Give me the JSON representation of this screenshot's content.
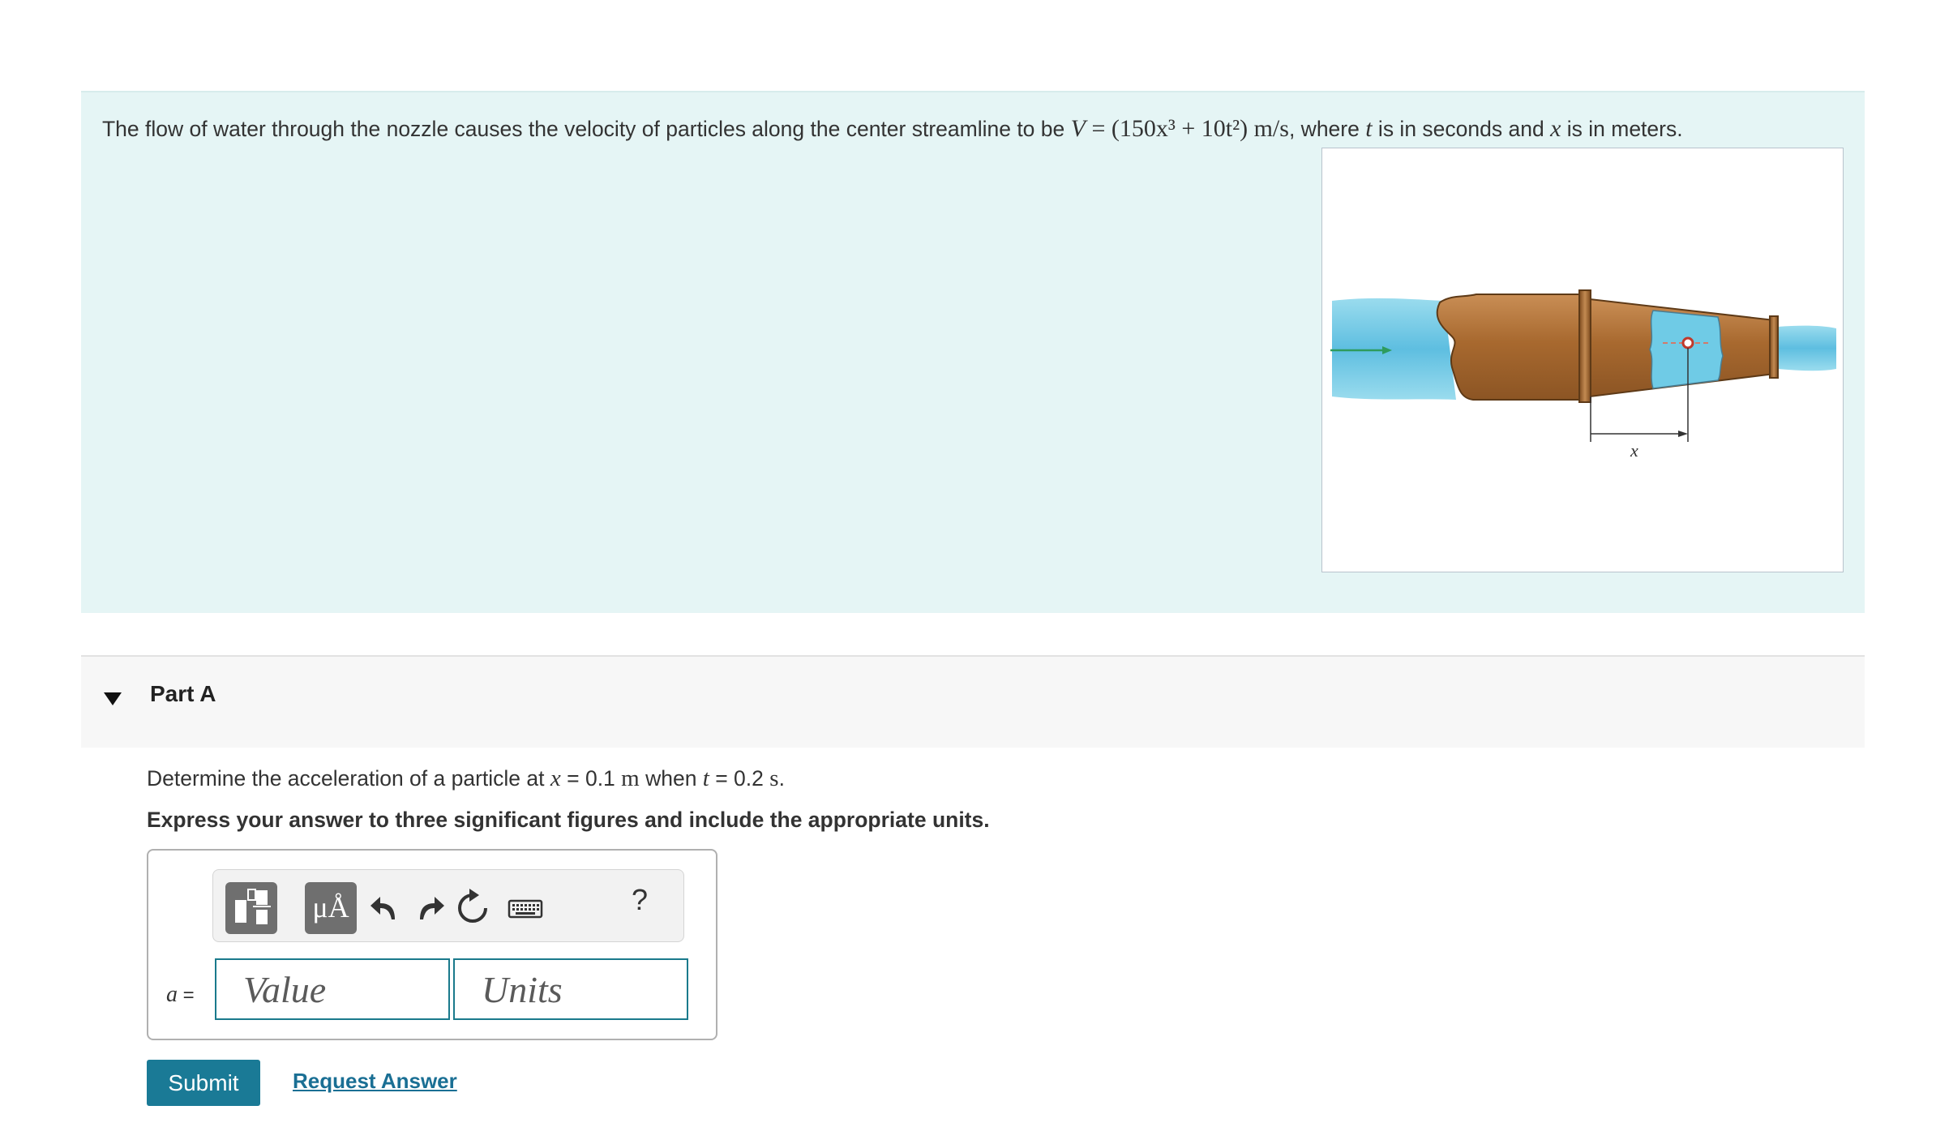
{
  "intro": {
    "text_before": "The flow of water through the nozzle causes the velocity of particles along the center streamline to be ",
    "equation_lhs": "V",
    "equation_rhs": " = (150x³ + 10t²) m/s",
    "text_after": ", where ",
    "var_t": "t",
    "text_mid": " is in seconds and ",
    "var_x": "x",
    "text_end": " is in meters.",
    "figure_label_x": "x"
  },
  "part": {
    "title": "Part A",
    "question_before": "Determine the acceleration of a particle at ",
    "question_var_x": "x",
    "question_x_value": " = 0.1 ",
    "question_x_unit": "m",
    "question_mid": " when ",
    "question_var_t": "t",
    "question_t_value": " = 0.2 ",
    "question_t_unit": "s",
    "question_end": ".",
    "instructions": "Express your answer to three significant figures and include the appropriate units."
  },
  "answer": {
    "variable": "a",
    "equals": " =",
    "value_placeholder": "Value",
    "units_placeholder": "Units"
  },
  "toolbar": {
    "units_symbol": "μÅ",
    "help_label": "?",
    "icons": [
      "templates-icon",
      "units-icon",
      "undo-icon",
      "redo-icon",
      "reset-icon",
      "keyboard-icon",
      "help-icon"
    ]
  },
  "actions": {
    "submit_label": "Submit",
    "request_answer_label": "Request Answer"
  },
  "colors": {
    "intro_bg": "#e5f5f5",
    "part_header_bg": "#f7f7f7",
    "submit_bg": "#1a7a96",
    "link": "#1a6f94",
    "input_border": "#1a7a8c",
    "nozzle_copper": "#b8763a",
    "water": "#5bc3e0"
  }
}
